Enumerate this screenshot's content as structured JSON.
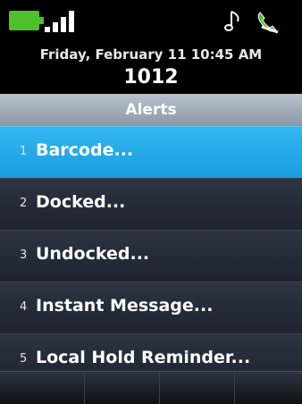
{
  "status": {
    "battery_icon": "battery-full-icon",
    "signal_icon": "signal-strength-icon",
    "ringer_icon": "music-note-icon",
    "line_icon": "phone-handset-icon",
    "colors": {
      "battery": "#4ec02a",
      "handset": "#4ec02a"
    }
  },
  "header": {
    "datetime": "Friday, February 11 10:45 AM",
    "extension": "1012"
  },
  "screen_title": "Alerts",
  "menu": {
    "items": [
      {
        "number": "1",
        "label": "Barcode..."
      },
      {
        "number": "2",
        "label": "Docked..."
      },
      {
        "number": "3",
        "label": "Undocked..."
      },
      {
        "number": "4",
        "label": "Instant Message..."
      },
      {
        "number": "5",
        "label": "Local Hold Reminder..."
      }
    ],
    "selected_index": 0,
    "selected_color": "#1fa8e8"
  },
  "softkeys": [
    "",
    "",
    "",
    ""
  ]
}
